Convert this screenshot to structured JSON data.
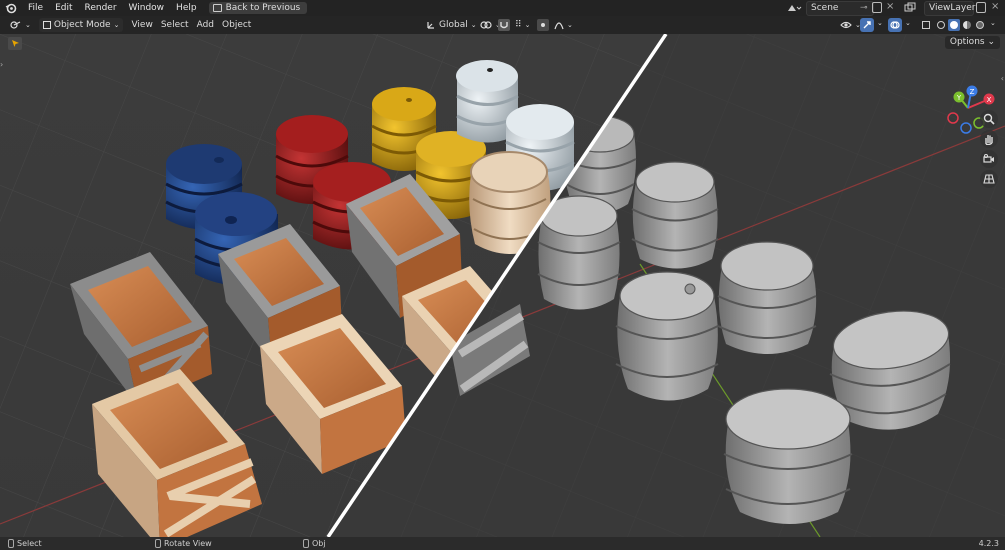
{
  "topbar": {
    "menus": [
      "File",
      "Edit",
      "Render",
      "Window",
      "Help"
    ],
    "back_button": "Back to Previous",
    "scene": "Scene",
    "view_layer": "ViewLayer"
  },
  "header": {
    "mode": "Object Mode",
    "menus": [
      "View",
      "Select",
      "Add",
      "Object"
    ],
    "transform_orientation": "Global",
    "options": "Options"
  },
  "statusbar": {
    "select": "Select",
    "rotate": "Rotate View",
    "object": "Obj",
    "version": "4.2.3"
  },
  "gizmo": {
    "x": "X",
    "y": "Y",
    "z": "Z"
  },
  "colors": {
    "accent": "#4772b3",
    "axis_x": "#e0394c",
    "axis_y": "#7bbf2e",
    "axis_z": "#3b7ce6",
    "barrel_blue": "#1e3a72",
    "barrel_red": "#8c1717",
    "barrel_yellow": "#c79a12",
    "barrel_white": "#c9d2d8",
    "crate_wood": "#c57a45"
  }
}
